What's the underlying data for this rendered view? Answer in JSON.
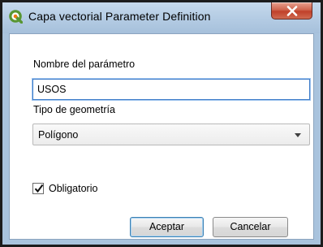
{
  "window": {
    "title": "Capa vectorial Parameter Definition",
    "close_label": "X"
  },
  "form": {
    "name_label": "Nombre del parámetro",
    "name_value": "USOS",
    "geometry_label": "Tipo de geometría",
    "geometry_selected": "Polígono",
    "required_label": "Obligatorio",
    "required_checked": true
  },
  "buttons": {
    "accept": "Aceptar",
    "cancel": "Cancelar"
  },
  "colors": {
    "qgis_green": "#589632",
    "close_red": "#c0402a",
    "input_focus_border": "#3d7cc9"
  }
}
